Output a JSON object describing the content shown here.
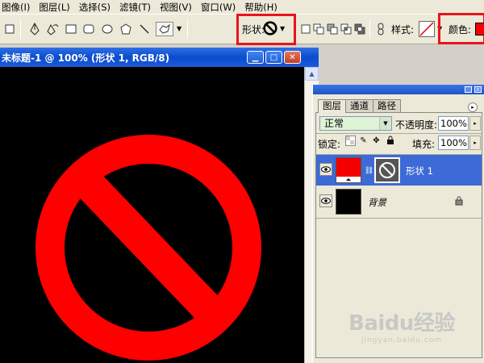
{
  "menu": [
    "图像(I)",
    "图层(L)",
    "选择(S)",
    "滤镜(T)",
    "视图(V)",
    "窗口(W)",
    "帮助(H)"
  ],
  "options_bar": {
    "shape_label": "形状:",
    "style_label": "样式:",
    "color_label": "颜色:",
    "shape_icon": "no-symbol-icon",
    "fill_color": "#f40000"
  },
  "document": {
    "title": "未标题-1 @ 100% (形状 1, RGB/8)",
    "canvas_background": "#000000",
    "shape_color": "#ff0000",
    "shape": "prohibition-sign"
  },
  "layers_panel": {
    "tabs": [
      "图层",
      "通道",
      "路径"
    ],
    "active_tab": "图层",
    "blend_mode": "正常",
    "opacity_label": "不透明度:",
    "opacity_value": "100%",
    "lock_label": "锁定:",
    "fill_label": "填充:",
    "fill_value": "100%",
    "layers": [
      {
        "name": "形状 1",
        "selected": true,
        "thumb_color": "#f40000",
        "has_vector_mask": true
      },
      {
        "name": "背景",
        "selected": false,
        "thumb_color": "#000000",
        "locked": true
      }
    ]
  },
  "watermark": {
    "logo": "Baidu经验",
    "sub": "jingyan.baidu.com"
  }
}
